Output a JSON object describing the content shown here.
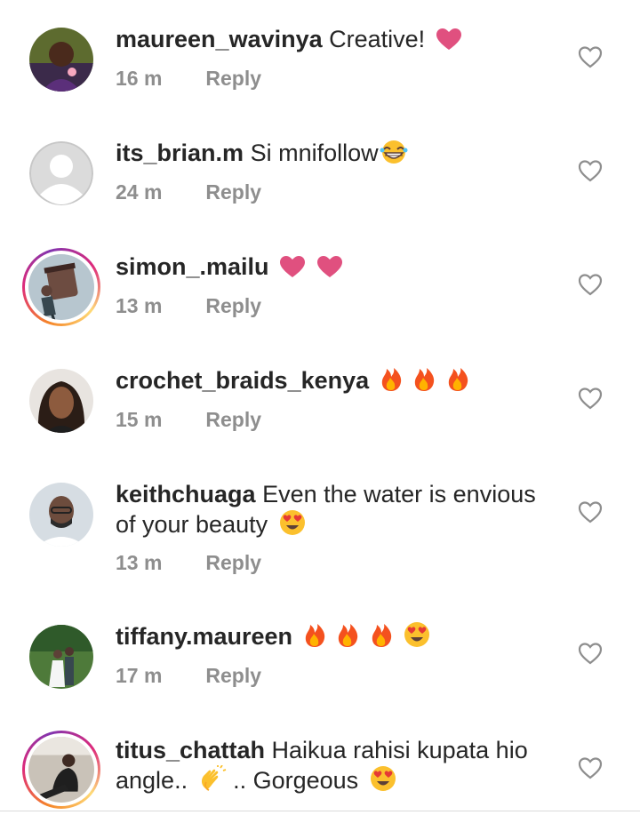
{
  "reply_label": "Reply",
  "comments": [
    {
      "username": "maureen_wavinya",
      "text": "Creative!",
      "emojis": [
        "heart-emoji"
      ],
      "time": "16 m"
    },
    {
      "username": "its_brian.m",
      "text": "Si mnifollow",
      "emojis": [
        "grin-emoji"
      ],
      "time": "24 m"
    },
    {
      "username": "simon_.mailu",
      "text": "",
      "emojis": [
        "heart-emoji",
        "heart-emoji"
      ],
      "time": "13 m"
    },
    {
      "username": "crochet_braids_kenya",
      "text": "",
      "emojis": [
        "fire-emoji",
        "fire-emoji",
        "fire-emoji"
      ],
      "time": "15 m"
    },
    {
      "username": "keithchuaga",
      "text": "Even the water is envious of your beauty",
      "emojis": [
        "heart-eyes-emoji"
      ],
      "time": "13 m"
    },
    {
      "username": "tiffany.maureen",
      "text": "",
      "emojis": [
        "fire-emoji",
        "fire-emoji",
        "fire-emoji",
        "heart-eyes-emoji"
      ],
      "time": "17 m"
    },
    {
      "username": "titus_chattah",
      "text_a": "Haikua rahisi kupata hio angle..",
      "text_b": ".. Gorgeous",
      "emojis": [
        "clap-emoji",
        "heart-eyes-emoji"
      ],
      "time": ""
    }
  ],
  "icons": {
    "like": "heart-outline-icon"
  },
  "colors": {
    "pink_heart": "#e0507f",
    "meta_grey": "#8e8e8e",
    "fire": "#f4511e",
    "emoji_yellow": "#fbc02d"
  }
}
